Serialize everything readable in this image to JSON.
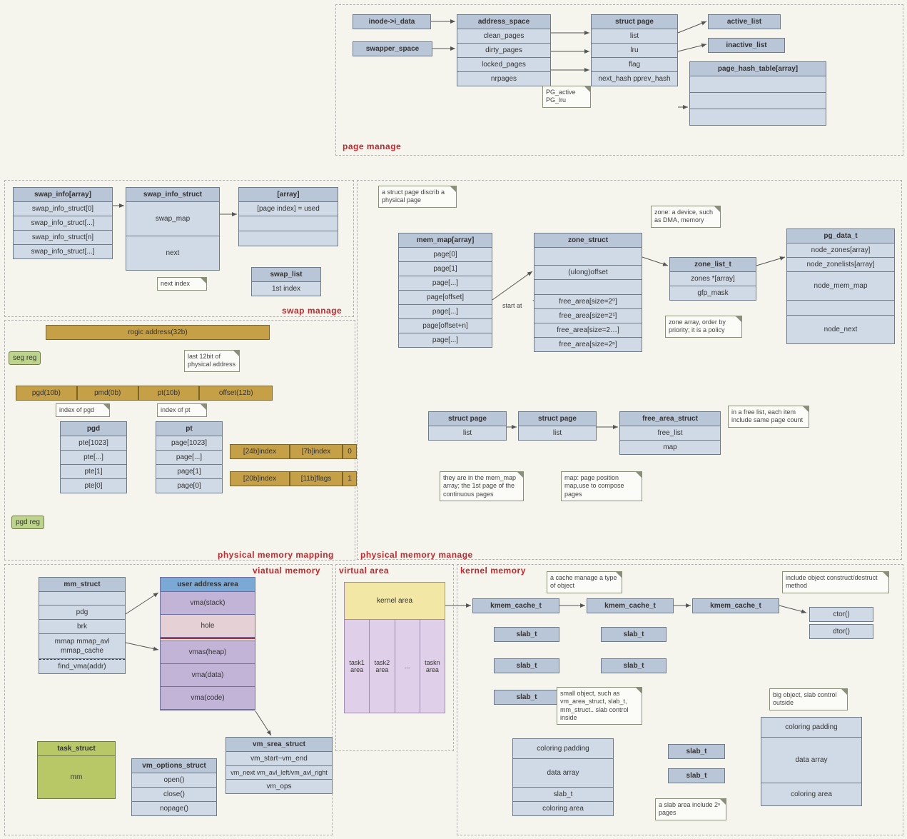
{
  "regions": {
    "page_manage": "page manage",
    "swap_manage": "swap manage",
    "phys_map": "physical memory mapping",
    "phys_manage": "physical memory manage",
    "virt_mem": "viatual memory",
    "virt_area": "virtual area",
    "kernel_mem": "kernel memory"
  },
  "page_manage": {
    "inode": "inode->i_data",
    "swapper": "swapper_space",
    "address_space": {
      "title": "address_space",
      "rows": [
        "clean_pages",
        "dirty_pages",
        "locked_pages",
        "nrpages"
      ]
    },
    "struct_page": {
      "title": "struct page",
      "rows": [
        "list",
        "lru",
        "flag",
        "next_hash  pprev_hash"
      ]
    },
    "active_list": "active_list",
    "inactive_list": "inactive_list",
    "page_hash": {
      "title": "page_hash_table[array]"
    },
    "flag_note": "PG_active\nPG_lru"
  },
  "swap": {
    "swap_info_arr": {
      "title": "swap_info[array]",
      "rows": [
        "swap_info_struct[0]",
        "swap_info_struct[...]",
        "swap_info_struct[n]",
        "swap_info_struct[...]"
      ]
    },
    "swap_info_struct": {
      "title": "swap_info_struct",
      "rows": [
        "swap_map",
        "next"
      ]
    },
    "swap_list": {
      "title": "swap_list",
      "rows": [
        "1st index"
      ]
    },
    "array": {
      "title": "[array]",
      "rows": [
        "[page index] = used"
      ]
    },
    "next_index": "next index"
  },
  "mapping": {
    "rogic": "rogic address(32b)",
    "segreg": "seg reg",
    "pgdreg": "pgd reg",
    "row": {
      "pgd": "pgd(10b)",
      "pmd": "pmd(0b)",
      "pt": "pt(10b)",
      "offset": "offset(12b)"
    },
    "idx_pgd": "index of pgd",
    "idx_pt": "index of pt",
    "addr_note": "last 12bit\nof physical\naddress",
    "pgd": {
      "title": "pgd",
      "rows": [
        "pte[1023]",
        "pte[...]",
        "pte[1]",
        "pte[0]"
      ]
    },
    "pt": {
      "title": "pt",
      "rows": [
        "page[1023]",
        "page[...]",
        "page[1]",
        "page[0]"
      ]
    },
    "line1": {
      "a": "[24b]index",
      "b": "[7b]index",
      "c": "0"
    },
    "line2": {
      "a": "[20b]index",
      "b": "[11b]flags",
      "c": "1"
    }
  },
  "phys": {
    "note_struct_page": "a struct page\ndiscrib a physical\npage",
    "mem_map": {
      "title": "mem_map[array]",
      "rows": [
        "page[0]",
        "page[1]",
        "page[...]",
        "page[offset]",
        "page[...]",
        "page[offset+n]",
        "page[...]"
      ]
    },
    "start_at": "start at",
    "zone_struct": {
      "title": "zone_struct",
      "rows": [
        "(ulong)offset",
        "free_area[size=2⁰]",
        "free_area[size=2¹]",
        "free_area[size=2…]",
        "free_area[size=2ⁿ]"
      ]
    },
    "zone_note": "zone: a device,\nsuch as DMA,\nmemory",
    "zone_list": {
      "title": "zone_list_t",
      "rows": [
        "zones *[array]",
        "gfp_mask"
      ]
    },
    "zone_arr_note": "zone array,\norder by priority;\nit is a policy",
    "pg_data": {
      "title": "pg_data_t",
      "rows": [
        "node_zones[array]",
        "node_zonelists[array]",
        "node_mem_map",
        "node_next"
      ]
    },
    "sp1": {
      "title": "struct page",
      "rows": [
        "list"
      ]
    },
    "sp2": {
      "title": "struct page",
      "rows": [
        "list"
      ]
    },
    "free_area": {
      "title": "free_area_struct",
      "rows": [
        "free_list",
        "map"
      ]
    },
    "free_note": "in a free list, each\nitem include same\npage count",
    "sp_note": "they are in the\nmem_map array;\nthe 1st page of the\ncontinuous pages",
    "map_note": "map: page\nposition map,use\nto compose pages"
  },
  "vmem": {
    "mm_struct": {
      "title": "mm_struct",
      "rows": [
        "pdg",
        "brk",
        "mmap  mmap_avl  mmap_cache",
        "find_vma(addr)"
      ]
    },
    "user_area": {
      "title": "user address area",
      "rows": [
        "vma(stack)",
        "hole",
        "",
        "vmas(heap)",
        "vma(data)",
        "vma(code)"
      ]
    },
    "vm_srea": {
      "title": "vm_srea_struct",
      "rows": [
        "vm_start~vm_end",
        "vm_next  vm_avl_left/vm_avl_right",
        "vm_ops"
      ]
    },
    "vm_opts": {
      "title": "vm_options_struct",
      "rows": [
        "open()",
        "close()",
        "nopage()"
      ]
    },
    "task_struct": {
      "title": "task_struct",
      "rows": [
        "mm"
      ]
    }
  },
  "varea": {
    "kernel": "kernel area",
    "t1": "task1 area",
    "t2": "task2 area",
    "tdots": "...",
    "tn": "taskn area"
  },
  "kmem": {
    "kct": "kmem_cache_t",
    "slab": "slab_t",
    "cache_note": "a cache manage a\ntype of object",
    "obj_note": "include object\nconstruct/destruct method",
    "ctor": "ctor()",
    "dtor": "dtor()",
    "small_note": "small object, such\nas vm_area_struct,\nslab_t, mm_struct..\nslab control inside",
    "big_note": "big object, slab\ncontrol outside",
    "slab_area": {
      "rows": [
        "coloring padding",
        "data array",
        "slab_t",
        "coloring area"
      ]
    },
    "slab_area2": {
      "rows": [
        "coloring padding",
        "data array",
        "coloring area"
      ]
    },
    "sa_note": "a slab area\ninclude 2ⁿ pages"
  }
}
